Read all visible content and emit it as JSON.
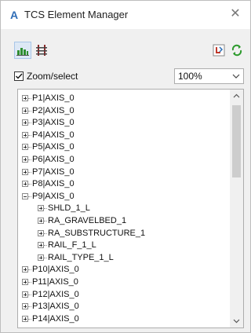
{
  "window": {
    "title": "TCS Element Manager"
  },
  "toolbar": {
    "view_button_icon": "buildings-view-icon",
    "layer_button_icon": "ladder-structure-icon",
    "export_button_icon": "export-icon",
    "refresh_button_icon": "refresh-icon"
  },
  "zoom": {
    "checkbox_label": "Zoom/select",
    "checked": true,
    "level": "100%"
  },
  "tree": {
    "items": [
      {
        "label": "P1|AXIS_0",
        "level": 0,
        "expanded": false
      },
      {
        "label": "P2|AXIS_0",
        "level": 0,
        "expanded": false
      },
      {
        "label": "P3|AXIS_0",
        "level": 0,
        "expanded": false
      },
      {
        "label": "P4|AXIS_0",
        "level": 0,
        "expanded": false
      },
      {
        "label": "P5|AXIS_0",
        "level": 0,
        "expanded": false
      },
      {
        "label": "P6|AXIS_0",
        "level": 0,
        "expanded": false
      },
      {
        "label": "P7|AXIS_0",
        "level": 0,
        "expanded": false
      },
      {
        "label": "P8|AXIS_0",
        "level": 0,
        "expanded": false
      },
      {
        "label": "P9|AXIS_0",
        "level": 0,
        "expanded": true
      },
      {
        "label": "SHLD_1_L",
        "level": 1,
        "expanded": false
      },
      {
        "label": "RA_GRAVELBED_1",
        "level": 1,
        "expanded": false
      },
      {
        "label": "RA_SUBSTRUCTURE_1",
        "level": 1,
        "expanded": false
      },
      {
        "label": "RAIL_F_1_L",
        "level": 1,
        "expanded": false
      },
      {
        "label": "RAIL_TYPE_1_L",
        "level": 1,
        "expanded": false
      },
      {
        "label": "P10|AXIS_0",
        "level": 0,
        "expanded": false
      },
      {
        "label": "P11|AXIS_0",
        "level": 0,
        "expanded": false
      },
      {
        "label": "P12|AXIS_0",
        "level": 0,
        "expanded": false
      },
      {
        "label": "P13|AXIS_0",
        "level": 0,
        "expanded": false
      },
      {
        "label": "P14|AXIS_0",
        "level": 0,
        "expanded": false
      }
    ]
  }
}
